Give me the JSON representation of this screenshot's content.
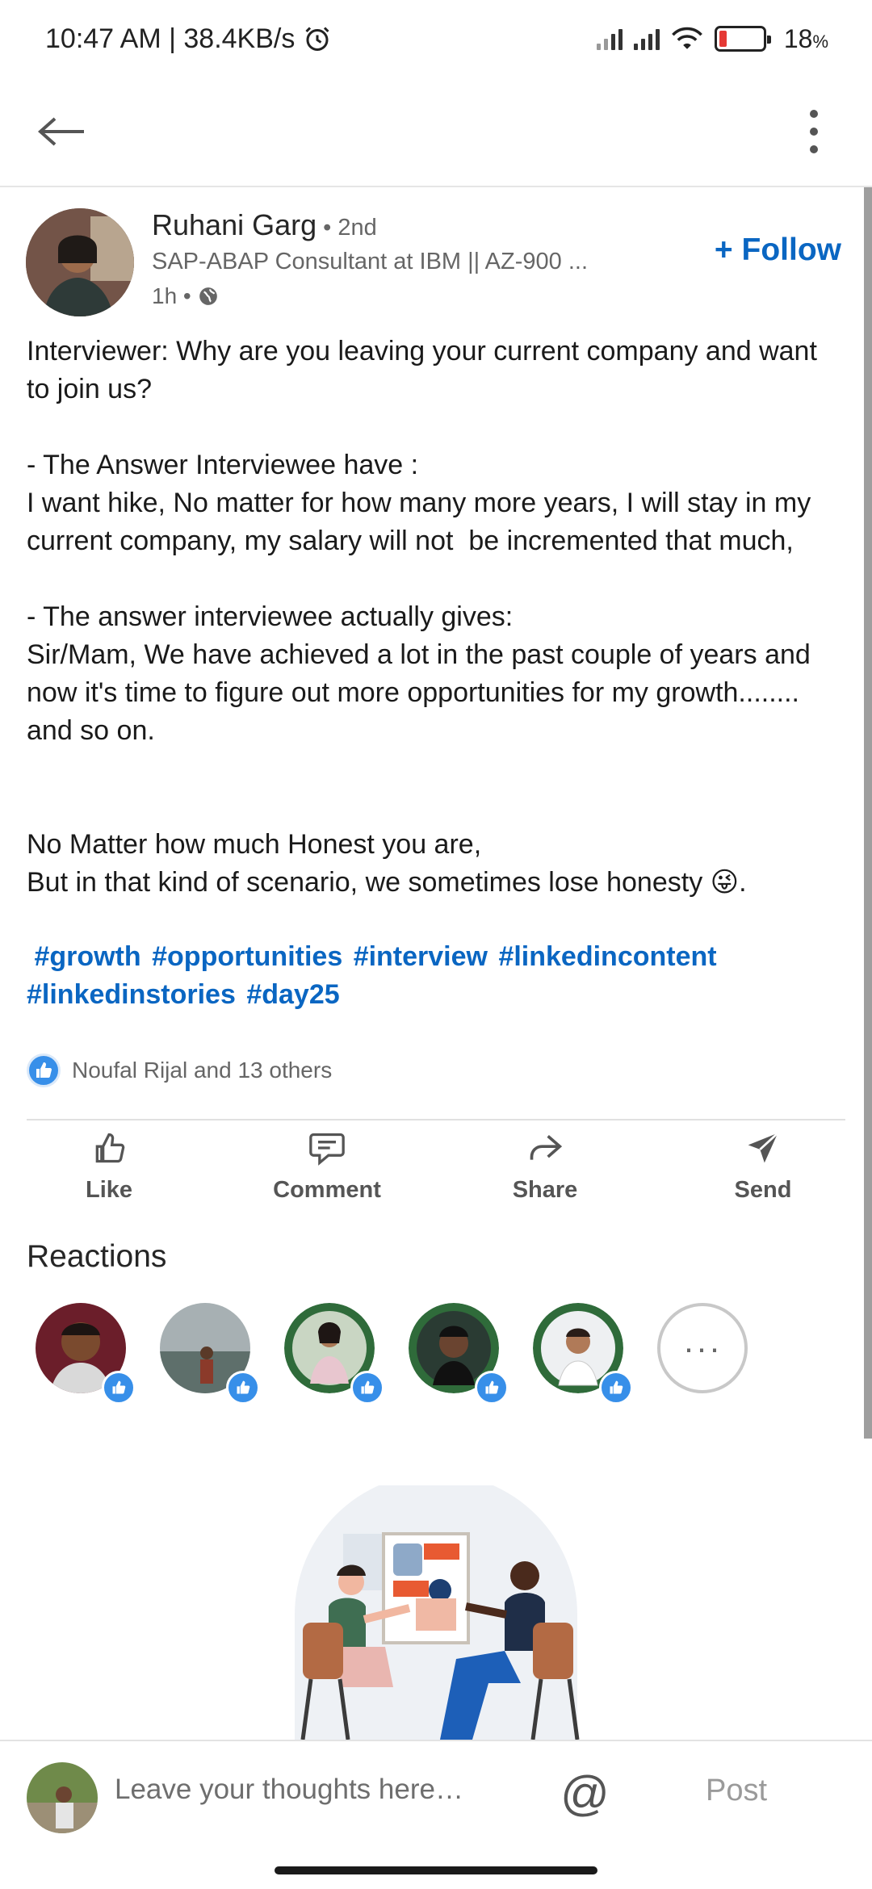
{
  "status_bar": {
    "time_speed": "10:47 AM | 38.4KB/s",
    "battery_pct": "18",
    "battery_unit": "%",
    "battery_level": 0.18,
    "battery_color": "#e53935"
  },
  "app_bar": {
    "back_icon": "arrow-left-icon",
    "menu_icon": "more-vertical-icon"
  },
  "post": {
    "author": {
      "name": "Ruhani Garg",
      "degree": " • 2nd",
      "headline": "SAP-ABAP Consultant at IBM || AZ-900 ...",
      "time": "1h •",
      "visibility_icon": "globe-icon"
    },
    "follow_label": "+ Follow",
    "body": [
      "Interviewer: Why are you leaving your current company and want to join us?",
      "",
      "- The Answer Interviewee have :",
      "I want hike, No matter for how many more years, I will stay in my current company, my salary will not  be incremented that much,",
      "",
      "- The answer interviewee actually gives:",
      "Sir/Mam, We have achieved a lot in the past couple of years and now it's time to figure out more opportunities for my growth........ and so on.",
      "",
      "",
      "No Matter how much Honest you are,",
      "But in that kind of scenario, we sometimes lose honesty 😜."
    ],
    "hashtags": [
      "#growth",
      "#opportunities",
      "#interview",
      "#linkedincontent",
      "#linkedinstories",
      "#day25"
    ],
    "reaction_summary": "Noufal Rijal and 13 others",
    "actions": [
      {
        "label": "Like",
        "icon": "thumbs-up-icon"
      },
      {
        "label": "Comment",
        "icon": "comment-icon"
      },
      {
        "label": "Share",
        "icon": "share-icon"
      },
      {
        "label": "Send",
        "icon": "send-icon"
      }
    ]
  },
  "reactions": {
    "title": "Reactions",
    "more_label": "···"
  },
  "comment_bar": {
    "placeholder": "Leave your thoughts here…",
    "mention_label": "@",
    "post_label": "Post"
  },
  "colors": {
    "brand_blue": "#0a66c2",
    "like_blue": "#378fe9"
  }
}
